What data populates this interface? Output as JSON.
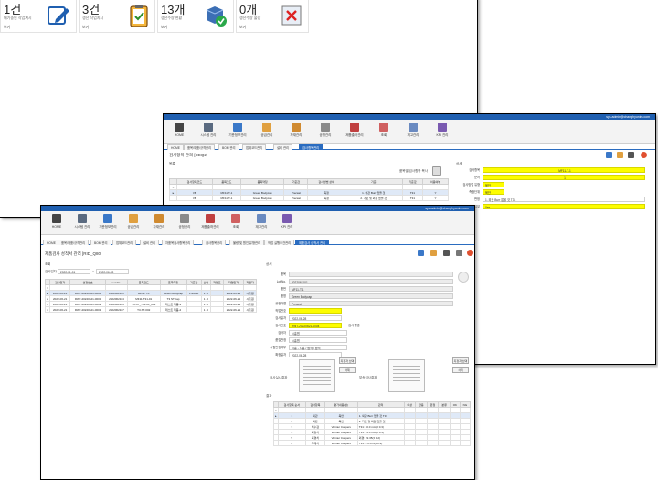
{
  "dashboard": {
    "cards": [
      {
        "count": "1건",
        "desc": "대기중인 작업지시",
        "more": "보기",
        "icon": "edit-icon"
      },
      {
        "count": "3건",
        "desc": "생산 작업지시",
        "more": "보기",
        "icon": "clipboard-check-icon"
      },
      {
        "count": "13개",
        "desc": "생산수량 현황",
        "more": "보기",
        "icon": "box-check-icon"
      },
      {
        "count": "0개",
        "desc": "생산수량 불량",
        "more": "보기",
        "icon": "defect-x-icon"
      }
    ]
  },
  "ribbon": {
    "items": [
      "HOME",
      "시스템 관리",
      "기준정보관리",
      "공급관리",
      "자재관리",
      "공정관리",
      "제품출하관리",
      "조회",
      "재고관리",
      "KPI 관리"
    ]
  },
  "window2": {
    "user": "sys.admin@changhyunim.com",
    "tabs": [
      "HOME",
      "품목/재품/규격관리",
      "BOM 관리",
      "업체코드관리",
      "설비 관리",
      "검사항목관리"
    ],
    "page_title": "검사항목 관리 [DEQ2]",
    "list_label": "목록",
    "detail_label": "상세",
    "button_text": "품목별 검사항목 복사",
    "grid_headers": [
      "검사항목코드",
      "품목코드",
      "품목약칭",
      "기준값",
      "검사방법 상세",
      "기준",
      "기준값",
      "이용여부"
    ],
    "grid_rows": [
      [
        "",
        "",
        "",
        "",
        "",
        "",
        "",
        ""
      ],
      [
        "VB",
        "MF11-T-1",
        "Green Bodycap",
        "Precast",
        "측정",
        "1. 외관 Burr 없을 것",
        "T31",
        "Y"
      ],
      [
        "VB",
        "MF11-T-1",
        "Green Bodycap",
        "Precast",
        "측정",
        "2. 가로 및 외경 없을 것",
        "T31",
        "Y"
      ]
    ],
    "fields": [
      {
        "label": "검사항목",
        "value": "MF11-T-1"
      },
      {
        "label": "순서",
        "value": "1"
      },
      {
        "label": "검사방법 유형",
        "value": "육안"
      },
      {
        "label": "측정단위",
        "value": "육안"
      },
      {
        "label": "판정",
        "value": "1. 외관 Burr 없을 것 T31"
      },
      {
        "label": "이용여부",
        "value": "Yes"
      }
    ]
  },
  "window3": {
    "tabs": [
      "HOME",
      "품목/재품/규격관리",
      "BOM 관리",
      "업체코드관리",
      "설비 관리",
      "자품목검사항목관리",
      "검사항목관리",
      "불량 및 원인 유형관리",
      "작업 실행조건관리",
      "제품검사 성적서 관리"
    ],
    "page_title": "제품검사 성적서 관리 [RID_Q80]",
    "search_label": "조회",
    "date_label": "검사일자",
    "date_from": "2022-01-01",
    "date_to": "2022-06-28",
    "grid_headers": [
      "검사일자",
      "설정번호",
      "Lot No.",
      "품목코드",
      "품목약칭",
      "기준값",
      "순번",
      "작업표",
      "작업일자",
      "작업자"
    ],
    "grid_rows": [
      [
        "",
        "",
        "",
        "",
        "",
        "",
        "",
        "",
        "",
        ""
      ],
      [
        "2022-06-21",
        "RWT-20220621-0004",
        "2022062101",
        "MF11-T-1",
        "Green Bodycap",
        "Precast",
        "1 ·5",
        "",
        "2022-06-21",
        "시흥원"
      ],
      [
        "2022-06-21",
        "RWT-20220621-0003",
        "2022062104",
        "MF11-T31-01",
        "T3 ST cap",
        "",
        "1 ·5",
        "",
        "2022-06-21",
        "시흥원"
      ],
      [
        "2022-06-21",
        "RWT-20220621-0002",
        "2022062103",
        "T3-ST_T31-01_003",
        "테스트 제품-3",
        "",
        "1 ·5",
        "",
        "2022-06-21",
        "시흥원"
      ],
      [
        "2022-06-21",
        "RWT-20220621-0001",
        "2022062107",
        "T3-ST-002",
        "테스트 제품-2",
        "",
        "1 ·5",
        "",
        "2022-06-21",
        "시흥원"
      ]
    ],
    "detail_label": "상세",
    "fields": [
      {
        "label": "품목",
        "value": "-"
      },
      {
        "label": "Lot No.",
        "value": "2022062101"
      },
      {
        "label": "품번",
        "value": "MF11-T-1"
      },
      {
        "label": "품명",
        "value": "Green Bodycap"
      },
      {
        "label": "공정라벨",
        "value": "Precast"
      },
      {
        "label": "작업번호",
        "value": ""
      },
      {
        "label": "검사일자",
        "value": "2022-06-28"
      },
      {
        "label": "검사번호",
        "value": "RWT-20220621-0004"
      },
      {
        "label": "검사자",
        "value": "시흥원"
      },
      {
        "label": "품질판정",
        "value": "시흥원"
      },
      {
        "label": "시험판정여부",
        "value": "시흥 - 시흥 / 합격 / 합격"
      },
      {
        "label": "확정일자",
        "value": "2022-06-28"
      }
    ],
    "note": "검사형중",
    "img1_label": "검사실시결과",
    "img2_label": "부속검사결과",
    "btn_attach": "지정자 선택",
    "btn_delete": "삭제",
    "result_label": "결과",
    "result_headers": [
      "검사항목 순서",
      "검사항목",
      "평가내용(상)",
      "관리",
      "이상",
      "관용",
      "판정",
      "분류",
      "OK",
      "NG"
    ],
    "result_rows": [
      [
        "1",
        "외관",
        "육안",
        "1. 외관 Burr 없을 것 T31"
      ],
      [
        "2",
        "외관",
        "육안",
        "2. 가로 및 외경 없을 것"
      ],
      [
        "3",
        "치수검",
        "Vernier Calipers",
        "T31: 10.0 mm(± 0.3)"
      ],
      [
        "4",
        "외경치",
        "Vernier Calipers",
        "T31: 13.6 mm(± 0.3)"
      ],
      [
        "5",
        "외경치",
        "Vernier Calipers",
        "외경: 22.35(± 0.2)"
      ],
      [
        "6",
        "두께치",
        "Vernier Calipers",
        "T31: 4.6 mm(± 0.2)"
      ]
    ]
  }
}
